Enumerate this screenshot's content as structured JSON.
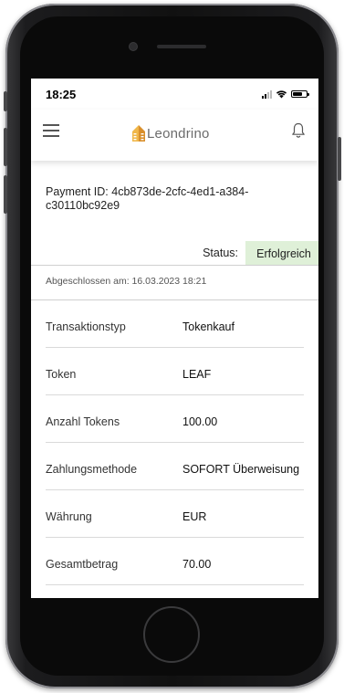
{
  "status_bar": {
    "time": "18:25",
    "battery_level": 0.7
  },
  "app_bar": {
    "logo_text": "Leondrino",
    "menu_icon": "hamburger-menu-icon",
    "notification_icon": "bell-icon",
    "brand_color": "#e0a43a"
  },
  "payment": {
    "id_line": "Payment ID: 4cb873de-2cfc-4ed1-a384-c30110bc92e9",
    "status_label": "Status:",
    "status_value": "Erfolgreich",
    "status_color": "#dff0d8",
    "completed_text": "Abgeschlossen am: 16.03.2023 18:21"
  },
  "details": [
    {
      "label": "Transaktionstyp",
      "value": "Tokenkauf"
    },
    {
      "label": "Token",
      "value": "LEAF"
    },
    {
      "label": "Anzahl Tokens",
      "value": "100.00"
    },
    {
      "label": "Zahlungsmethode",
      "value": "SOFORT Überweisung"
    },
    {
      "label": "Währung",
      "value": "EUR"
    },
    {
      "label": "Gesamtbetrag",
      "value": "70.00"
    }
  ]
}
